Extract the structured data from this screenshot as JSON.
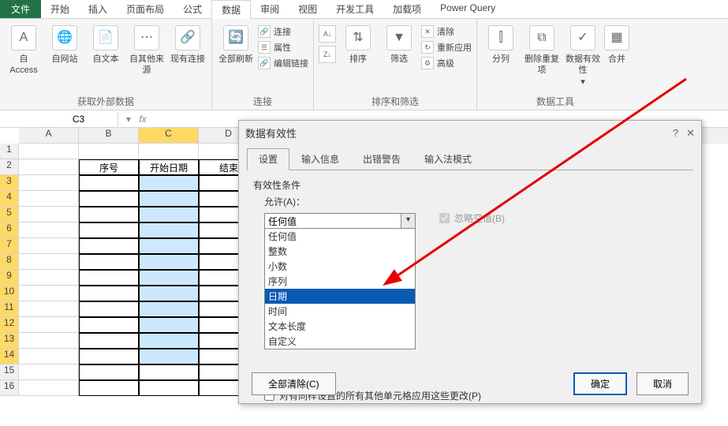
{
  "tabs": {
    "file": "文件",
    "home": "开始",
    "insert": "插入",
    "layout": "页面布局",
    "formula": "公式",
    "data": "数据",
    "review": "审阅",
    "view": "视图",
    "dev": "开发工具",
    "addin": "加载项",
    "pq": "Power Query"
  },
  "ribbon": {
    "ext": {
      "access": "自 Access",
      "web": "自网站",
      "text": "自文本",
      "other": "自其他来源",
      "conn": "现有连接",
      "group": "获取外部数据"
    },
    "conn": {
      "refresh": "全部刷新",
      "connections": "连接",
      "props": "属性",
      "edit": "编辑链接",
      "group": "连接"
    },
    "sort": {
      "sortbtn": "排序",
      "filter": "筛选",
      "clear": "清除",
      "reapply": "重新应用",
      "advanced": "高级",
      "group": "排序和筛选"
    },
    "tools": {
      "split": "分列",
      "dedup": "删除重复项",
      "valid": "数据有效性",
      "consol": "合并",
      "group": "数据工具"
    }
  },
  "namebox": "C3",
  "cols": [
    "A",
    "B",
    "C",
    "D"
  ],
  "rowcount": 16,
  "headers": {
    "b": "序号",
    "c": "开始日期",
    "d": "结束"
  },
  "dialog": {
    "title": "数据有效性",
    "tabs": {
      "settings": "设置",
      "input": "输入信息",
      "error": "出错警告",
      "ime": "输入法模式"
    },
    "cond_label": "有效性条件",
    "allow_label": "允许(A)：",
    "allow_value": "任何值",
    "options": [
      "任何值",
      "整数",
      "小数",
      "序列",
      "日期",
      "时间",
      "文本长度",
      "自定义"
    ],
    "selected_option_index": 4,
    "ignore_blank": "忽略空值(B)",
    "apply_all": "对有同样设置的所有其他单元格应用这些更改(P)",
    "clear_all": "全部清除(C)",
    "ok": "确定",
    "cancel": "取消"
  }
}
